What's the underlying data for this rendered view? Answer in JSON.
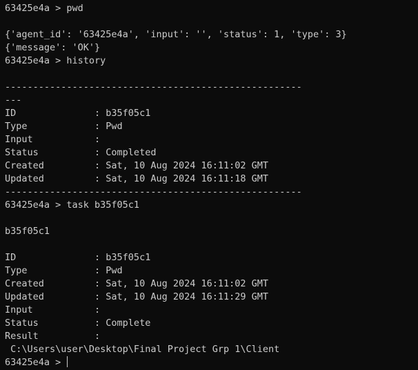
{
  "terminal": {
    "prompt_symbol": ">",
    "agent_prompt": "63425e4a >",
    "lines": [
      "63425e4a > pwd",
      "",
      "{'agent_id': '63425e4a', 'input': '', 'status': 1, 'type': 3}",
      "{'message': 'OK'}",
      "63425e4a > history",
      "",
      "-----------------------------------------------------",
      "---",
      "ID              : b35f05c1",
      "Type            : Pwd",
      "Input           :",
      "Status          : Completed",
      "Created         : Sat, 10 Aug 2024 16:11:02 GMT",
      "Updated         : Sat, 10 Aug 2024 16:11:18 GMT",
      "-----------------------------------------------------",
      "63425e4a > task b35f05c1",
      "",
      "b35f05c1",
      "",
      "ID              : b35f05c1",
      "Type            : Pwd",
      "Created         : Sat, 10 Aug 2024 16:11:02 GMT",
      "Updated         : Sat, 10 Aug 2024 16:11:29 GMT",
      "Input           :",
      "Status          : Complete",
      "Result          :",
      " C:\\Users\\user\\Desktop\\Final Project Grp 1\\Client"
    ],
    "current_prompt": "63425e4a > "
  }
}
